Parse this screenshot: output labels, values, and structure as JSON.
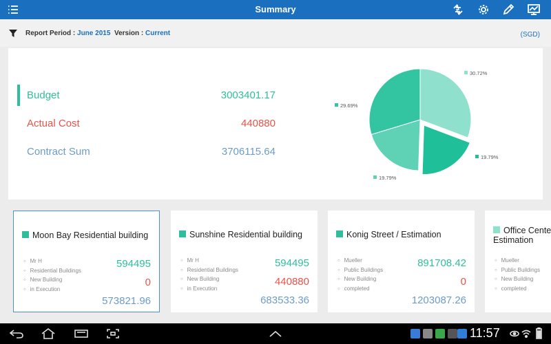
{
  "app": {
    "title": "Summary",
    "brand_color": "#1a6fbf"
  },
  "toolbar": {
    "menu_icon": "list-menu-icon",
    "actions": [
      "refresh-sync-icon",
      "settings-gear-icon",
      "edit-pencil-icon",
      "dashboard-chart-icon"
    ]
  },
  "report": {
    "period_label": "Report Period :",
    "period_value": "June 2015",
    "version_label": "Version :",
    "version_value": "Current",
    "currency": "(SGD)"
  },
  "summary": {
    "metrics": [
      {
        "label": "Budget",
        "value": "3003401.17",
        "color": "#2dbf9c"
      },
      {
        "label": "Actual Cost",
        "value": "440880",
        "color": "#e8534a"
      },
      {
        "label": "Contract Sum",
        "value": "3706115.64",
        "color": "#6b9cc8"
      }
    ]
  },
  "chart_data": {
    "type": "pie",
    "values": [
      30.72,
      19.79,
      19.79,
      29.69
    ],
    "labels": [
      "30.72%",
      "19.79%",
      "19.79%",
      "29.69%"
    ],
    "colors": [
      "#8fe0cc",
      "#1fbf99",
      "#5fd1b5",
      "#33c4a2"
    ],
    "exploded_index": 1
  },
  "cards": [
    {
      "title": "Moon Bay Residential building",
      "details": [
        "Mr H",
        "Residential Buildings",
        "New Building",
        "in Execution"
      ],
      "value1": "594495",
      "value2": "0",
      "value3": "573821.96"
    },
    {
      "title": "Sunshine Residential building",
      "details": [
        "Mr H",
        "Residential Buildings",
        "New Building",
        "in Execution"
      ],
      "value1": "594495",
      "value2": "440880",
      "value3": "683533.36"
    },
    {
      "title": "Konig Street / Estimation",
      "details": [
        "Mueller",
        "Public Buildings",
        "New Building",
        "completed"
      ],
      "value1": "891708.42",
      "value2": "0",
      "value3": "1203087.26"
    },
    {
      "title": "Office Center Estimation",
      "details": [
        "Mueller",
        "Public Buildings",
        "New Building",
        "completed"
      ]
    }
  ],
  "system": {
    "time": "11:57",
    "nav_icons": [
      "back-icon",
      "home-icon",
      "recent-apps-icon",
      "screenshot-icon",
      "up-arrow-icon"
    ]
  }
}
